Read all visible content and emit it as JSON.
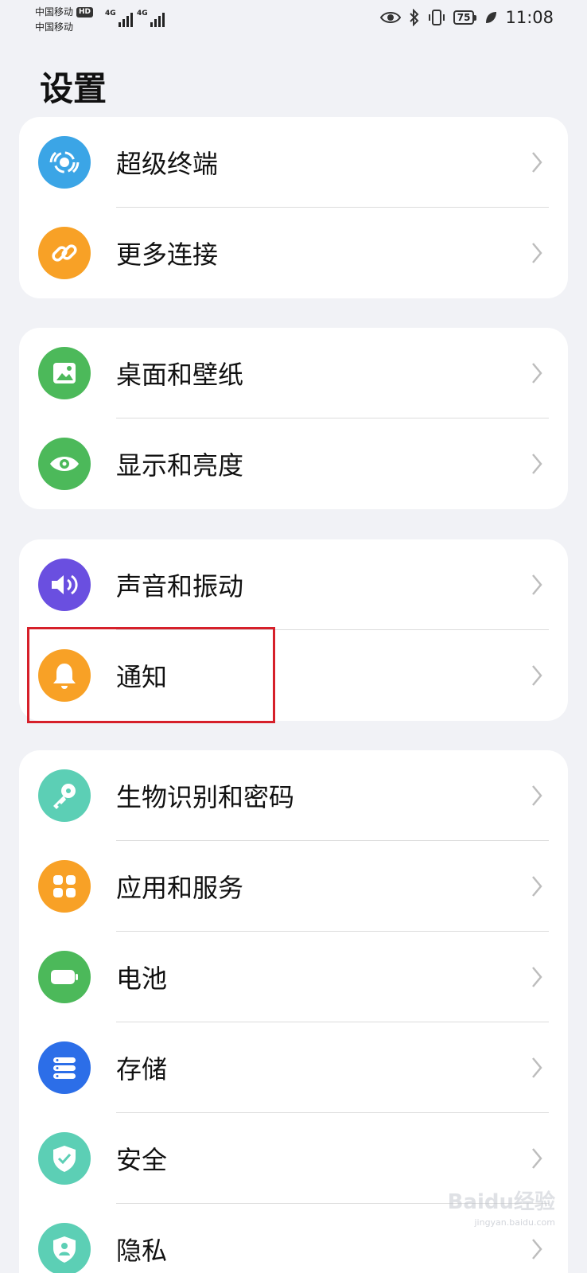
{
  "status_bar": {
    "carrier1": "中国移动",
    "carrier1_badge": "HD",
    "carrier2": "中国移动",
    "signal1_label": "4G",
    "signal2_label": "4G",
    "battery": "75",
    "time": "11:08"
  },
  "title": "设置",
  "groups": [
    {
      "items": [
        {
          "label": "超级终端",
          "icon": "super-device-icon",
          "color": "#3ba5e6"
        },
        {
          "label": "更多连接",
          "icon": "link-icon",
          "color": "#f8a126"
        }
      ]
    },
    {
      "items": [
        {
          "label": "桌面和壁纸",
          "icon": "wallpaper-icon",
          "color": "#4cb95a"
        },
        {
          "label": "显示和亮度",
          "icon": "eye-icon",
          "color": "#4cb95a"
        }
      ]
    },
    {
      "items": [
        {
          "label": "声音和振动",
          "icon": "speaker-icon",
          "color": "#6a4fe0"
        },
        {
          "label": "通知",
          "icon": "bell-icon",
          "color": "#f8a126"
        }
      ]
    },
    {
      "items": [
        {
          "label": "生物识别和密码",
          "icon": "key-icon",
          "color": "#5ccfb5"
        },
        {
          "label": "应用和服务",
          "icon": "apps-icon",
          "color": "#f8a126"
        },
        {
          "label": "电池",
          "icon": "battery-icon",
          "color": "#4cb95a"
        },
        {
          "label": "存储",
          "icon": "storage-icon",
          "color": "#2c6ee8"
        },
        {
          "label": "安全",
          "icon": "shield-icon",
          "color": "#5ccfb5"
        },
        {
          "label": "隐私",
          "icon": "privacy-icon",
          "color": "#5ccfb5"
        }
      ]
    }
  ],
  "watermark": {
    "text": "Baidu经验",
    "sub": "jingyan.baidu.com"
  }
}
